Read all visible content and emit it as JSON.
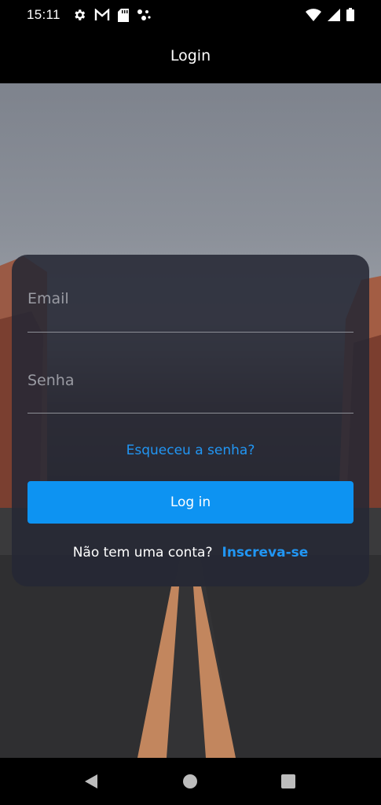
{
  "status_bar": {
    "time": "15:11",
    "left_icons": [
      "gear-icon",
      "gmail-icon",
      "sd-card-icon",
      "dots-icon"
    ],
    "right_icons": [
      "wifi-icon",
      "signal-icon",
      "battery-icon"
    ]
  },
  "app_bar": {
    "title": "Login"
  },
  "form": {
    "email_label": "Email",
    "password_label": "Senha",
    "forgot_link": "Esqueceu a senha?",
    "login_button": "Log in",
    "no_account_text": "Não tem uma conta?",
    "signup_link": "Inscreva-se"
  },
  "colors": {
    "accent": "#2196f3",
    "button": "#0d93f2",
    "card": "#262834"
  },
  "nav_bar": {
    "icons": [
      "back-icon",
      "home-icon",
      "recents-icon"
    ]
  }
}
